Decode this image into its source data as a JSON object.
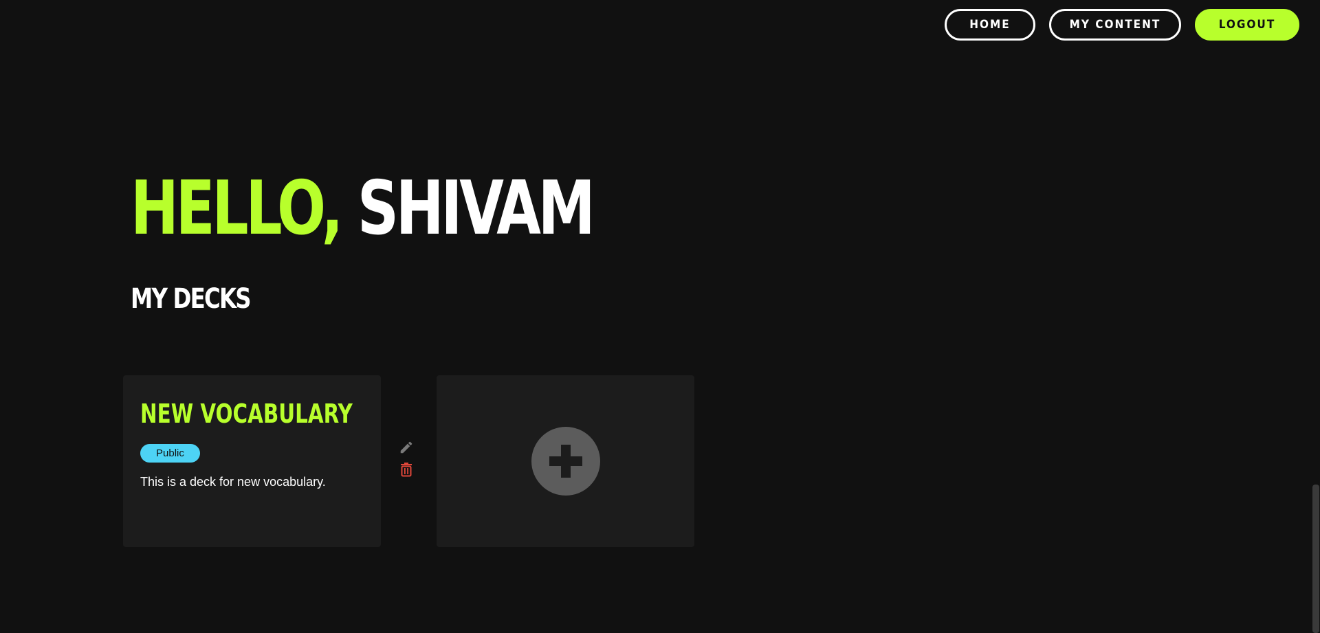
{
  "nav": {
    "home_label": "HOME",
    "content_label": "MY CONTENT",
    "logout_label": "LOGOUT"
  },
  "greeting": {
    "hello": "HELLO,",
    "name": "SHIVAM"
  },
  "section_title": "MY DECKS",
  "decks": [
    {
      "title": "NEW VOCABULARY",
      "visibility": "Public",
      "description": "This is a deck for new vocabulary."
    }
  ],
  "icons": {
    "edit": "pencil-icon",
    "delete": "trash-icon",
    "add": "plus-icon"
  },
  "colors": {
    "accent": "#b8ff2c",
    "background": "#111111",
    "card": "#1c1c1c",
    "badge": "#4dd3f5",
    "delete": "#e0473a"
  }
}
